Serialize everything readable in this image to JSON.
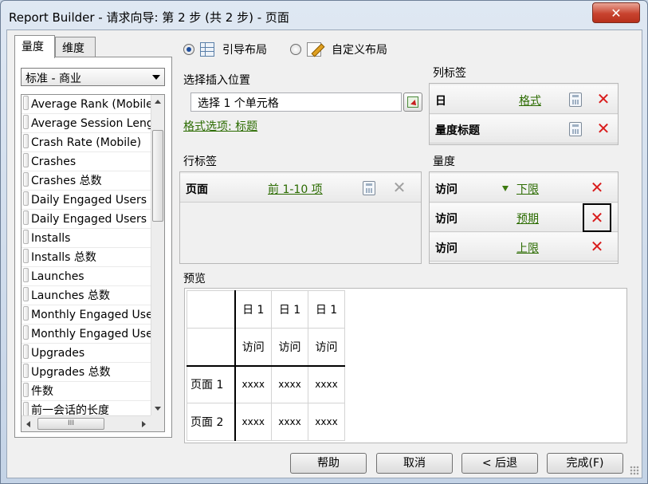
{
  "window": {
    "title": "Report Builder - 请求向导: 第 2 步 (共 2 步) - 页面",
    "close_glyph": "✕"
  },
  "left_panel": {
    "tabs": [
      {
        "label": "量度",
        "active": true
      },
      {
        "label": "维度",
        "active": false
      }
    ],
    "dropdown": {
      "value": "标准 - 商业"
    },
    "items": [
      "Average Rank (Mobile)",
      "Average Session Length",
      "Crash Rate (Mobile)",
      "Crashes",
      "Crashes 总数",
      "Daily Engaged Users",
      "Daily Engaged Users 总数",
      "Installs",
      "Installs 总数",
      "Launches",
      "Launches 总数",
      "Monthly Engaged Users",
      "Monthly Engaged Users",
      "Upgrades",
      "Upgrades 总数",
      "件数",
      "前一会话的长度"
    ],
    "hscroll_thumb": "III"
  },
  "layout": {
    "guided_label": "引导布局",
    "custom_label": "自定义布局",
    "guided_selected": true
  },
  "insert": {
    "label": "选择插入位置",
    "input_value": "选择 1 个单元格",
    "format_link": "格式选项: 标题"
  },
  "column_labels": {
    "title": "列标签",
    "rows": [
      {
        "name": "日",
        "link": "格式"
      },
      {
        "name": "量度标题",
        "link": ""
      }
    ]
  },
  "row_labels": {
    "title": "行标签",
    "rows": [
      {
        "name": "页面",
        "link": "前 1-10 项"
      }
    ]
  },
  "metrics": {
    "title": "量度",
    "rows": [
      {
        "name": "访问",
        "link": "下限",
        "has_arrow": true
      },
      {
        "name": "访问",
        "link": "预期",
        "has_arrow": false
      },
      {
        "name": "访问",
        "link": "上限",
        "has_arrow": false
      }
    ]
  },
  "preview": {
    "title": "预览",
    "header_day": "日 1",
    "header_metric": "访问",
    "rows": [
      {
        "label": "页面 1",
        "value": "xxxx"
      },
      {
        "label": "页面 2",
        "value": "xxxx"
      }
    ]
  },
  "buttons": {
    "help": "帮助",
    "cancel": "取消",
    "back": "< 后退",
    "finish": "完成(F)"
  }
}
